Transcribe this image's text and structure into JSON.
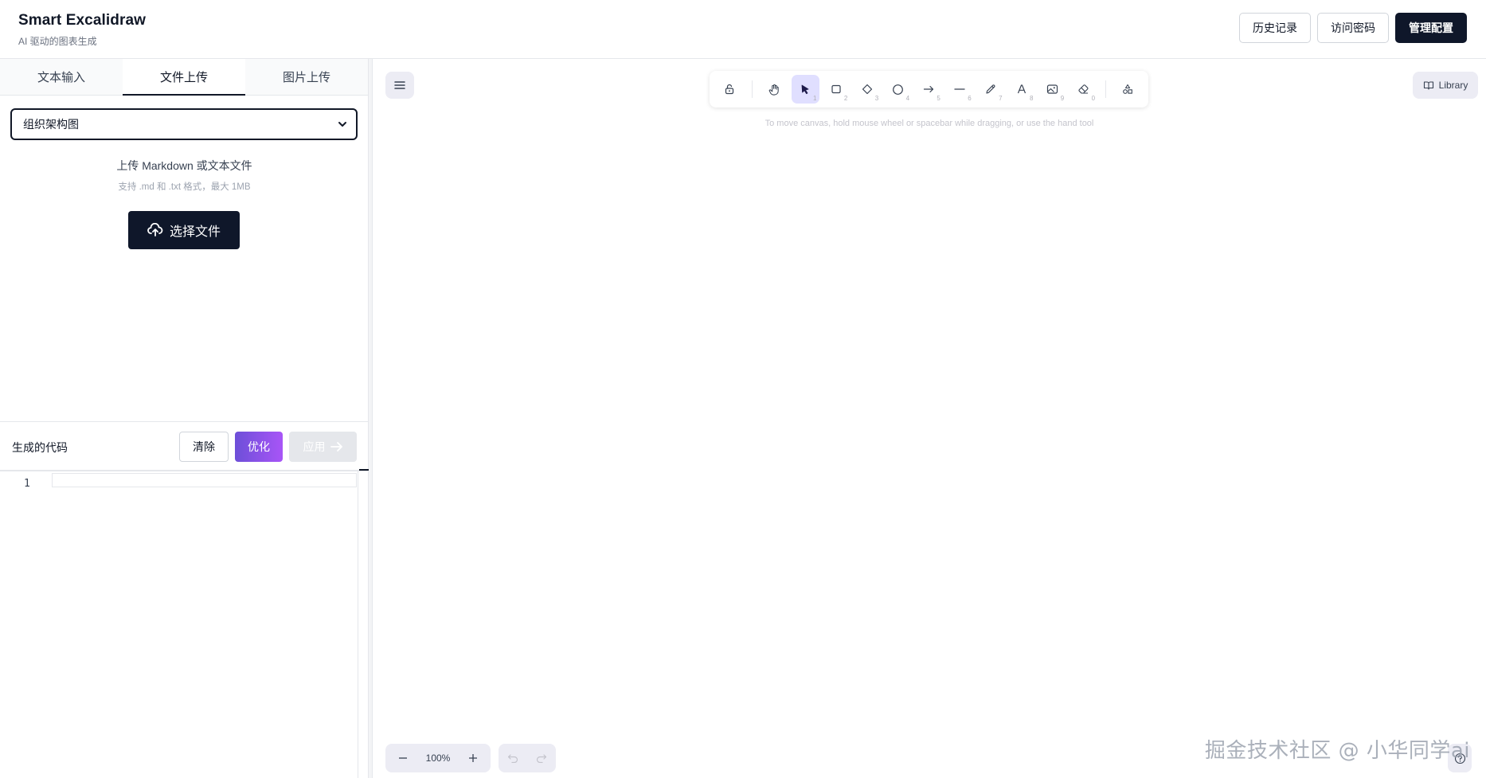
{
  "header": {
    "title": "Smart Excalidraw",
    "subtitle": "AI 驱动的图表生成",
    "actions": [
      {
        "label": "历史记录"
      },
      {
        "label": "访问密码"
      },
      {
        "label": "管理配置"
      }
    ]
  },
  "left_panel": {
    "tabs": [
      {
        "label": "文本输入"
      },
      {
        "label": "文件上传",
        "active": true
      },
      {
        "label": "图片上传"
      }
    ],
    "diagram_type": {
      "selected": "组织架构图"
    },
    "upload": {
      "title": "上传 Markdown 或文本文件",
      "hint": "支持 .md 和 .txt 格式，最大 1MB",
      "button_label": "选择文件",
      "button_icon": "cloud-upload-icon"
    },
    "code": {
      "label": "生成的代码",
      "clear_label": "清除",
      "optimize_label": "优化",
      "apply_label": "应用",
      "line_number": "1"
    }
  },
  "canvas": {
    "hint": "To move canvas, hold mouse wheel or spacebar while dragging, or use the hand tool",
    "library_label": "Library",
    "zoom": "100%",
    "toolbar": [
      {
        "name": "lock",
        "icon": "lock-icon",
        "num": ""
      },
      {
        "name": "hand",
        "icon": "hand-icon",
        "num": ""
      },
      {
        "name": "selection",
        "icon": "pointer-icon",
        "num": "1",
        "active": true
      },
      {
        "name": "rectangle",
        "icon": "rectangle-icon",
        "num": "2"
      },
      {
        "name": "diamond",
        "icon": "diamond-icon",
        "num": "3"
      },
      {
        "name": "ellipse",
        "icon": "ellipse-icon",
        "num": "4"
      },
      {
        "name": "arrow",
        "icon": "arrow-icon",
        "num": "5"
      },
      {
        "name": "line",
        "icon": "line-icon",
        "num": "6"
      },
      {
        "name": "draw",
        "icon": "pencil-icon",
        "num": "7"
      },
      {
        "name": "text",
        "icon": "text-icon",
        "num": "8"
      },
      {
        "name": "image",
        "icon": "image-icon",
        "num": "9"
      },
      {
        "name": "eraser",
        "icon": "eraser-icon",
        "num": "0"
      },
      {
        "name": "more-shapes",
        "icon": "shapes-icon",
        "num": ""
      }
    ]
  },
  "watermark": "掘金技术社区 @ 小华同学ai",
  "colors": {
    "primary_dark": "#0f172a",
    "active_tool": "#e0dfff",
    "optimize_gradient_start": "#6d4fd8",
    "optimize_gradient_end": "#a855f7"
  }
}
